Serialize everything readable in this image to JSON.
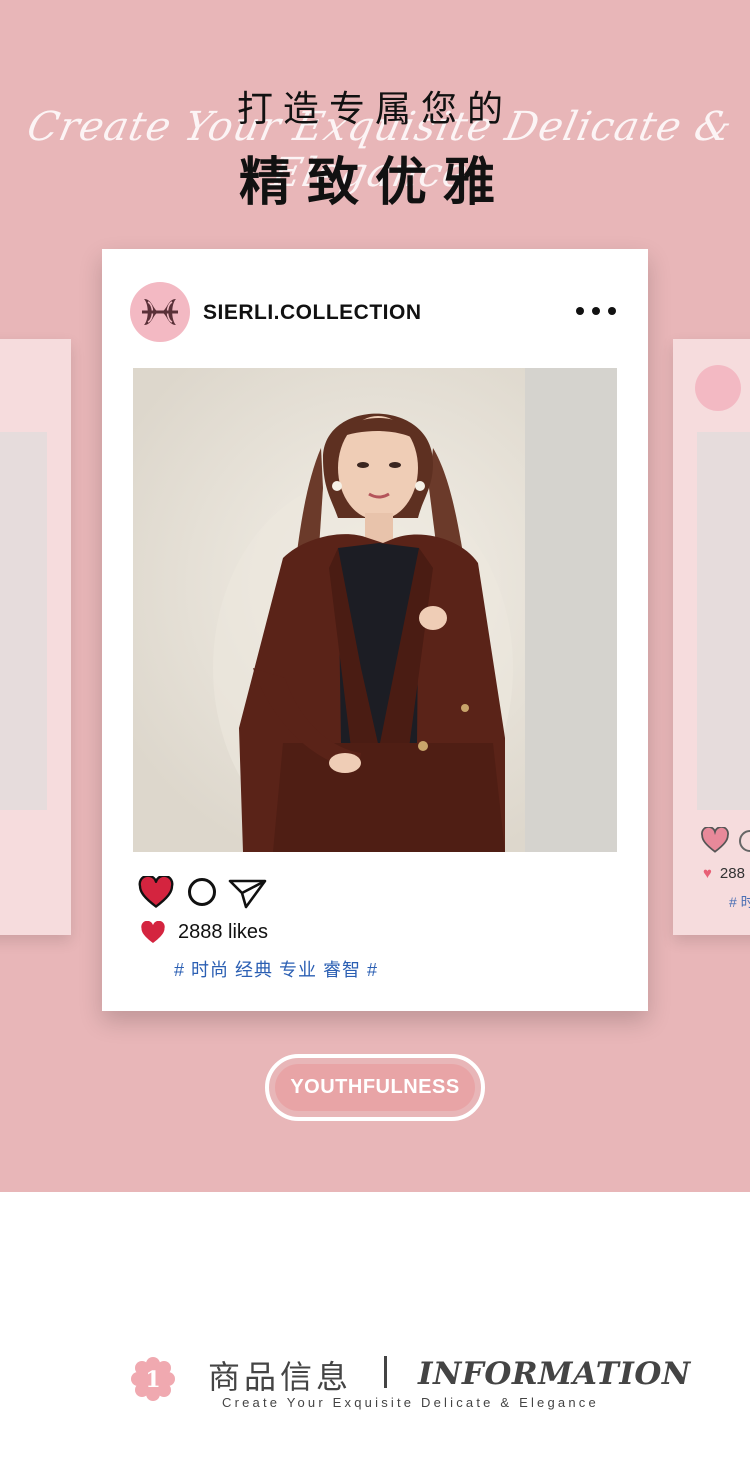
{
  "hero": {
    "script_line": "Create Your Exquisite Delicate & Elegance",
    "title_small": "打造专属您的",
    "title_big": "精致优雅"
  },
  "post": {
    "handle": "SIERLI.COLLECTION",
    "more_icon": "more-dots-icon",
    "likes": "2888 likes",
    "tags": "# 时尚 经典 专业 睿智 #"
  },
  "side_right": {
    "likes_fragment": "288",
    "tags_fragment": "# 时"
  },
  "badge_pill": {
    "label": "YOUTHFULNESS"
  },
  "info": {
    "number": "1",
    "title_cn": "商品信息",
    "title_en": "INFORMATION",
    "subtitle": "Create Your Exquisite Delicate & Elegance"
  },
  "colors": {
    "hero_bg": "#e8b6b8",
    "card_bg": "#ffffff",
    "heart_red": "#d4243f",
    "tag_blue": "#2b5fb3",
    "pill_fill": "#e8a4a6",
    "logo_pink": "#f3b9c3"
  }
}
